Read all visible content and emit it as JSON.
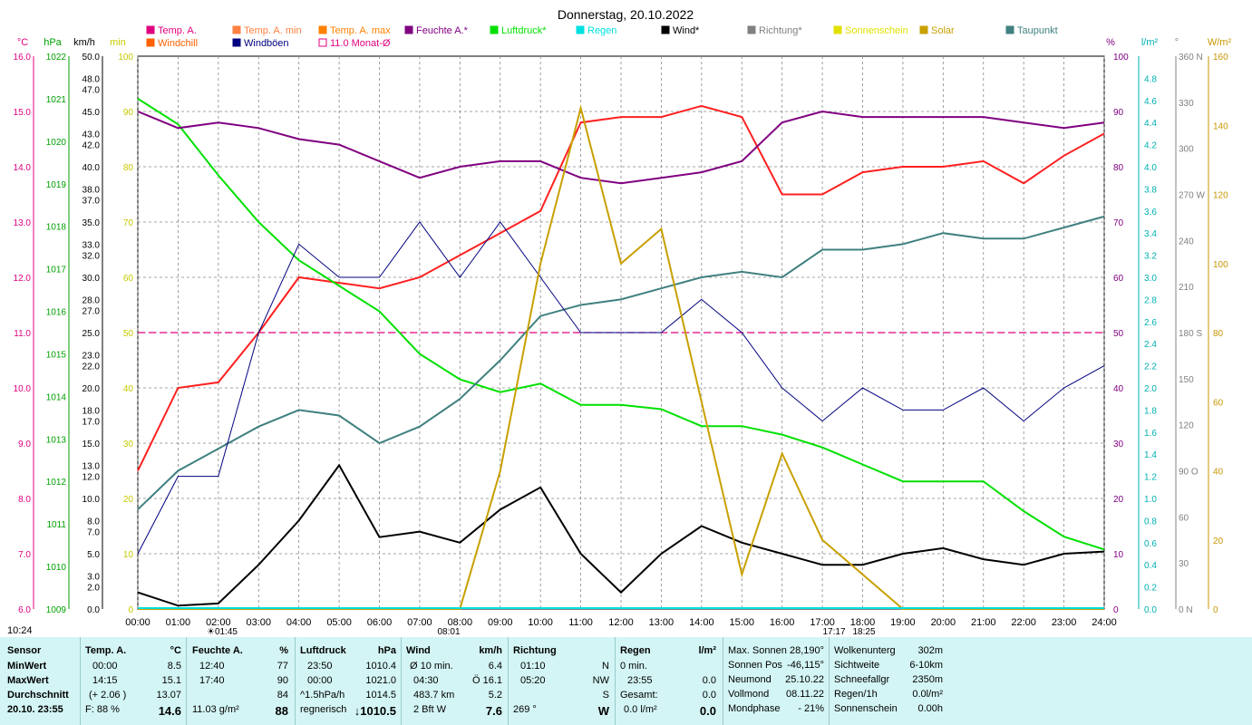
{
  "chart_data": {
    "type": "line",
    "title": "Donnerstag, 20.10.2022",
    "x": [
      "00:00",
      "01:00",
      "02:00",
      "03:00",
      "04:00",
      "05:00",
      "06:00",
      "07:00",
      "08:00",
      "09:00",
      "10:00",
      "11:00",
      "12:00",
      "13:00",
      "14:00",
      "15:00",
      "16:00",
      "17:00",
      "18:00",
      "19:00",
      "20:00",
      "21:00",
      "22:00",
      "23:00",
      "24:00"
    ],
    "axes_left": {
      "celsius": {
        "unit": "°C",
        "color": "#e0007f",
        "ticks": [
          "16.0",
          "15.0",
          "14.0",
          "13.0",
          "12.0",
          "11.0",
          "10.0",
          "9.0",
          "8.0",
          "7.0",
          "6.0"
        ],
        "range": [
          6,
          16
        ]
      },
      "hpa": {
        "unit": "hPa",
        "color": "#00a000",
        "ticks": [
          "1022",
          "1021",
          "1020",
          "1019",
          "1018",
          "1017",
          "1016",
          "1015",
          "1014",
          "1013",
          "1012",
          "1011",
          "1010",
          "1009"
        ],
        "range": [
          1009,
          1022
        ]
      },
      "kmh": {
        "unit": "km/h",
        "color": "#000000",
        "ticks": [
          "50.0",
          "48.0",
          "47.0",
          "45.0",
          "43.0",
          "42.0",
          "40.0",
          "38.0",
          "37.0",
          "35.0",
          "33.0",
          "32.0",
          "30.0",
          "28.0",
          "27.0",
          "25.0",
          "23.0",
          "22.0",
          "20.0",
          "18.0",
          "17.0",
          "15.0",
          "13.0",
          "12.0",
          "10.0",
          "8.0",
          "7.0",
          "5.0",
          "3.0",
          "2.0",
          "0.0"
        ]
      },
      "min": {
        "unit": "min",
        "color": "#c8c800",
        "ticks": [
          "100",
          "90",
          "80",
          "70",
          "60",
          "50",
          "40",
          "30",
          "20",
          "10",
          "0"
        ]
      }
    },
    "axes_right": {
      "percent": {
        "unit": "%",
        "color": "#800080",
        "ticks": [
          "100",
          "90",
          "80",
          "70",
          "60",
          "50",
          "40",
          "30",
          "20",
          "10",
          "0"
        ]
      },
      "lm2": {
        "unit": "l/m²",
        "color": "#00b0b0",
        "ticks": [
          "4.8",
          "4.6",
          "4.4",
          "4.2",
          "4.0",
          "3.8",
          "3.6",
          "3.4",
          "3.2",
          "3.0",
          "2.8",
          "2.6",
          "2.4",
          "2.2",
          "2.0",
          "1.8",
          "1.6",
          "1.4",
          "1.2",
          "1.0",
          "0.8",
          "0.6",
          "0.4",
          "0.2",
          "0.0"
        ]
      },
      "deg": {
        "unit": "°",
        "color": "#808080",
        "ticks": [
          "360 N",
          "330",
          "300",
          "270 W",
          "240",
          "210",
          "180 S",
          "150",
          "120",
          "90 O",
          "60",
          "30",
          "0 N"
        ]
      },
      "wm2": {
        "unit": "W/m²",
        "color": "#c89600",
        "ticks": [
          "160",
          "140",
          "120",
          "100",
          "80",
          "60",
          "40",
          "20",
          "0"
        ]
      }
    },
    "legend": [
      {
        "name": "Temp. A.",
        "color": "#e0007f"
      },
      {
        "name": "Windchill",
        "color": "#ff6000"
      },
      {
        "name": "Temp. A. min",
        "color": "#ff8040"
      },
      {
        "name": "Windböen",
        "color": "#000080"
      },
      {
        "name": "Temp. A. max",
        "color": "#ff8000"
      },
      {
        "name": "11.0 Monat-Ø",
        "color": "#e0007f"
      },
      {
        "name": "Feuchte A.*",
        "color": "#800080"
      },
      {
        "name": "Luftdruck*",
        "color": "#00e000"
      },
      {
        "name": "Regen",
        "color": "#00e0e0"
      },
      {
        "name": "Wind*",
        "color": "#000000"
      },
      {
        "name": "Richtung*",
        "color": "#808080"
      },
      {
        "name": "Sonnenschein",
        "color": "#e0e000"
      },
      {
        "name": "Solar",
        "color": "#c8a000"
      },
      {
        "name": "Taupunkt",
        "color": "#408080"
      }
    ],
    "series": [
      {
        "name": "Temp. A.",
        "color": "#ff2020",
        "unit": "°C",
        "values": [
          8.5,
          10.0,
          10.1,
          11.0,
          12.0,
          11.9,
          11.8,
          12.0,
          12.4,
          12.8,
          13.2,
          14.8,
          14.9,
          14.9,
          15.1,
          14.9,
          13.5,
          13.5,
          13.9,
          14.0,
          14.0,
          14.1,
          13.7,
          14.2,
          14.6
        ]
      },
      {
        "name": "Luftdruck*",
        "color": "#00e000",
        "unit": "hPa",
        "values": [
          1021.0,
          1020.4,
          1019.2,
          1018.1,
          1017.2,
          1016.6,
          1016.0,
          1015.0,
          1014.4,
          1014.1,
          1014.3,
          1013.8,
          1013.8,
          1013.7,
          1013.3,
          1013.3,
          1013.1,
          1012.8,
          1012.4,
          1012.0,
          1012.0,
          1012.0,
          1011.3,
          1010.7,
          1010.4
        ]
      },
      {
        "name": "Feuchte A.*",
        "color": "#800080",
        "unit": "%",
        "values": [
          90,
          87,
          88,
          87,
          85,
          84,
          81,
          78,
          80,
          81,
          81,
          78,
          77,
          78,
          79,
          81,
          88,
          90,
          89,
          89,
          89,
          89,
          88,
          87,
          88
        ]
      },
      {
        "name": "Taupunkt",
        "color": "#408080",
        "unit": "°C",
        "values": [
          7.8,
          8.5,
          8.9,
          9.3,
          9.6,
          9.5,
          9.0,
          9.3,
          9.8,
          10.5,
          11.3,
          11.5,
          11.6,
          11.8,
          12.0,
          12.1,
          12.0,
          12.5,
          12.5,
          12.6,
          12.8,
          12.7,
          12.7,
          12.9,
          13.1
        ]
      },
      {
        "name": "Wind*",
        "color": "#000000",
        "unit": "km/h",
        "values": [
          1.5,
          0.3,
          0.5,
          4.0,
          8.0,
          13.0,
          6.5,
          7.0,
          6.0,
          9.0,
          11.0,
          5.0,
          1.5,
          5.0,
          7.5,
          6.0,
          5.0,
          4.0,
          4.0,
          5.0,
          5.5,
          4.5,
          4.0,
          5.0,
          5.2
        ]
      },
      {
        "name": "Windböen",
        "color": "#000080",
        "unit": "km/h",
        "values": [
          5,
          12,
          12,
          25,
          33,
          30,
          30,
          35,
          30,
          35,
          30,
          25,
          25,
          25,
          28,
          25,
          20,
          17,
          20,
          18,
          18,
          20,
          17,
          20,
          22
        ]
      },
      {
        "name": "Solar",
        "color": "#c8a000",
        "unit": "W/m²",
        "values": [
          0,
          0,
          0,
          0,
          0,
          0,
          0,
          0,
          0,
          40,
          100,
          145,
          100,
          110,
          60,
          10,
          45,
          20,
          10,
          0,
          0,
          0,
          0,
          0,
          0
        ]
      }
    ],
    "monthly_average": {
      "label": "11.0 Monat-Ø",
      "value": 11.0
    },
    "x_markers": [
      {
        "label": "☀01:45"
      },
      {
        "label": "08:01"
      },
      {
        "label": "17:17"
      },
      {
        "label": "18:25"
      }
    ],
    "side_labels": {
      "left_bottom": "10:24"
    },
    "grid": true
  },
  "table": {
    "row_headers": {
      "sensor": "Sensor",
      "min": "MinWert",
      "max": "MaxWert",
      "avg": "Durchschnitt",
      "now": "20.10. 23:55"
    },
    "temp": {
      "title": "Temp. A.",
      "unit": "°C",
      "min_time": "00:00",
      "min_val": "8.5",
      "max_time": "14:15",
      "max_val": "15.1",
      "avg_delta": "(+ 2.06 )",
      "avg_val": "13.07",
      "now_label": "F: 88 %",
      "now_val": "14.6"
    },
    "hum": {
      "title": "Feuchte A.",
      "unit": "%",
      "min_time": "12:40",
      "min_val": "77",
      "max_time": "17:40",
      "max_val": "90",
      "avg_val": "84",
      "now_label": "11.03 g/m²",
      "now_val": "88"
    },
    "press": {
      "title": "Luftdruck",
      "unit": "hPa",
      "min_time": "23:50",
      "min_val": "1010.4",
      "max_time": "00:00",
      "max_val": "1021.0",
      "avg_label": "^1.5hPa/h",
      "avg_val": "1014.5",
      "now_label": "regnerisch",
      "now_val": "↓1010.5"
    },
    "wind": {
      "title": "Wind",
      "unit": "km/h",
      "r1_label": "Ø 10 min.",
      "r1_val": "6.4",
      "r2_label": "04:30",
      "r2_val": "Ö 16.1",
      "r3_label": "483.7 km",
      "r3_val": "5.2",
      "r4_label": "2 Bft W",
      "r4_val": "7.6"
    },
    "dir": {
      "title": "Richtung",
      "r1_label": "01:10",
      "r1_val": "N",
      "r2_label": "05:20",
      "r2_val": "NW",
      "r3_label": "",
      "r3_val": "S",
      "r4_label": "269 °",
      "r4_val": "W"
    },
    "rain": {
      "title": "Regen",
      "unit": "l/m²",
      "r1_label": "0 min.",
      "r1_val": "",
      "r2_label": "23:55",
      "r2_val": "0.0",
      "r3_label": "Gesamt:",
      "r3_val": "0.0",
      "r4_label": "0.0 l/m²",
      "r4_val": "0.0"
    },
    "astro": [
      {
        "label": "Max. Sonnen",
        "value": "28,190°"
      },
      {
        "label": "Sonnen Pos",
        "value": "-46,115°"
      },
      {
        "label": "Neumond",
        "value": "25.10.22"
      },
      {
        "label": "Vollmond",
        "value": "08.11.22"
      },
      {
        "label": "Mondphase",
        "value": "- 21%"
      }
    ],
    "cloud": [
      {
        "label": "Wolkenunterg",
        "value": "302m"
      },
      {
        "label": "Sichtweite",
        "value": "6-10km"
      },
      {
        "label": "Schneefallgr",
        "value": "2350m"
      },
      {
        "label": "Regen/1h",
        "value": "0.0l/m²"
      },
      {
        "label": "Sonnenschein",
        "value": "0.00h"
      }
    ]
  }
}
